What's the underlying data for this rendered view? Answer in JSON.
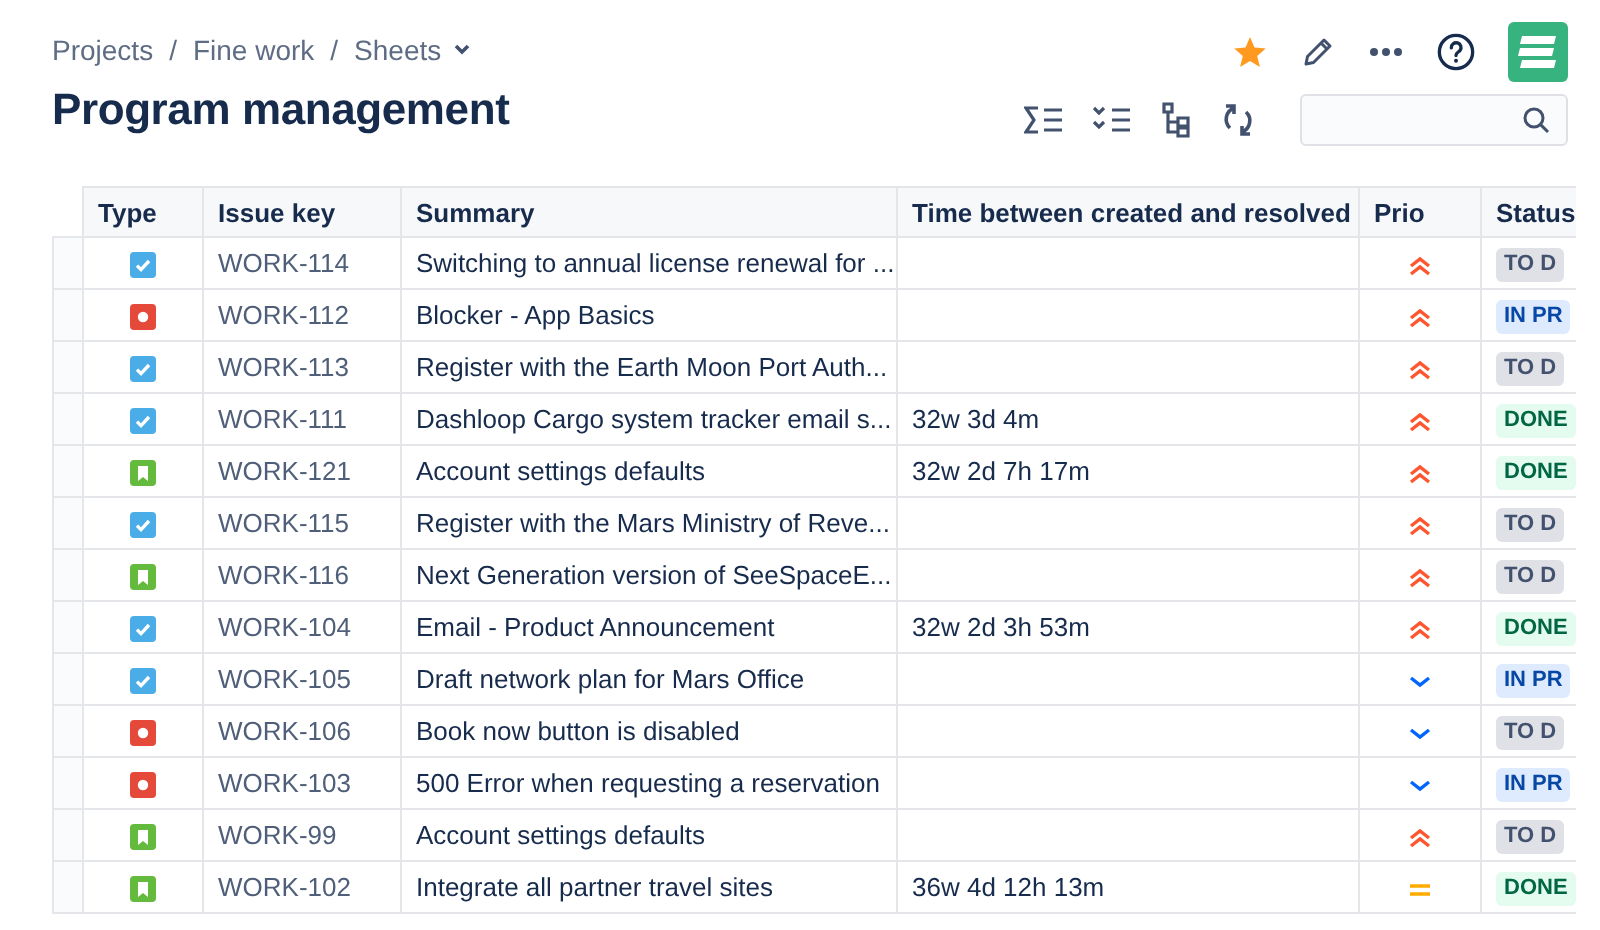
{
  "breadcrumbs": [
    {
      "label": "Projects",
      "separator": "/"
    },
    {
      "label": "Fine work",
      "separator": "/"
    },
    {
      "label": "Sheets"
    }
  ],
  "title": "Program management",
  "table": {
    "columns": [
      "Type",
      "Issue key",
      "Summary",
      "Time between created and resolved",
      "Prio",
      "Status"
    ],
    "rows": [
      {
        "type": {
          "kind": "task"
        },
        "key": "WORK-114",
        "summary": "Switching to annual license renewal for ...",
        "time": "",
        "priority": {
          "kind": "highest"
        },
        "status": {
          "label": "TO D",
          "kind": "todo"
        }
      },
      {
        "type": {
          "kind": "bug"
        },
        "key": "WORK-112",
        "summary": "Blocker - App Basics",
        "time": "",
        "priority": {
          "kind": "highest"
        },
        "status": {
          "label": "IN PR",
          "kind": "progress"
        }
      },
      {
        "type": {
          "kind": "task"
        },
        "key": "WORK-113",
        "summary": "Register with the Earth Moon Port Auth...",
        "time": "",
        "priority": {
          "kind": "highest"
        },
        "status": {
          "label": "TO D",
          "kind": "todo"
        }
      },
      {
        "type": {
          "kind": "task"
        },
        "key": "WORK-111",
        "summary": "Dashloop Cargo system tracker email s...",
        "time": "32w 3d 4m",
        "priority": {
          "kind": "highest"
        },
        "status": {
          "label": "DONE",
          "kind": "done"
        }
      },
      {
        "type": {
          "kind": "story"
        },
        "key": "WORK-121",
        "summary": "Account settings defaults",
        "time": "32w 2d 7h 17m",
        "priority": {
          "kind": "highest"
        },
        "status": {
          "label": "DONE",
          "kind": "done"
        }
      },
      {
        "type": {
          "kind": "task"
        },
        "key": "WORK-115",
        "summary": "Register with the Mars Ministry of Reve...",
        "time": "",
        "priority": {
          "kind": "highest"
        },
        "status": {
          "label": "TO D",
          "kind": "todo"
        }
      },
      {
        "type": {
          "kind": "story"
        },
        "key": "WORK-116",
        "summary": "Next Generation version of SeeSpaceE...",
        "time": "",
        "priority": {
          "kind": "highest"
        },
        "status": {
          "label": "TO D",
          "kind": "todo"
        }
      },
      {
        "type": {
          "kind": "task"
        },
        "key": "WORK-104",
        "summary": "Email - Product Announcement",
        "time": "32w 2d 3h 53m",
        "priority": {
          "kind": "highest"
        },
        "status": {
          "label": "DONE",
          "kind": "done"
        }
      },
      {
        "type": {
          "kind": "task"
        },
        "key": "WORK-105",
        "summary": "Draft network plan for Mars Office",
        "time": "",
        "priority": {
          "kind": "low"
        },
        "status": {
          "label": "IN PR",
          "kind": "progress"
        }
      },
      {
        "type": {
          "kind": "bug"
        },
        "key": "WORK-106",
        "summary": "Book now button is disabled",
        "time": "",
        "priority": {
          "kind": "low"
        },
        "status": {
          "label": "TO D",
          "kind": "todo"
        }
      },
      {
        "type": {
          "kind": "bug"
        },
        "key": "WORK-103",
        "summary": "500 Error when requesting a reservation",
        "time": "",
        "priority": {
          "kind": "low"
        },
        "status": {
          "label": "IN PR",
          "kind": "progress"
        }
      },
      {
        "type": {
          "kind": "story"
        },
        "key": "WORK-99",
        "summary": "Account settings defaults",
        "time": "",
        "priority": {
          "kind": "highest"
        },
        "status": {
          "label": "TO D",
          "kind": "todo"
        }
      },
      {
        "type": {
          "kind": "story"
        },
        "key": "WORK-102",
        "summary": "Integrate all partner travel sites",
        "time": "36w 4d 12h 13m",
        "priority": {
          "kind": "medium"
        },
        "status": {
          "label": "DONE",
          "kind": "done"
        }
      }
    ]
  }
}
